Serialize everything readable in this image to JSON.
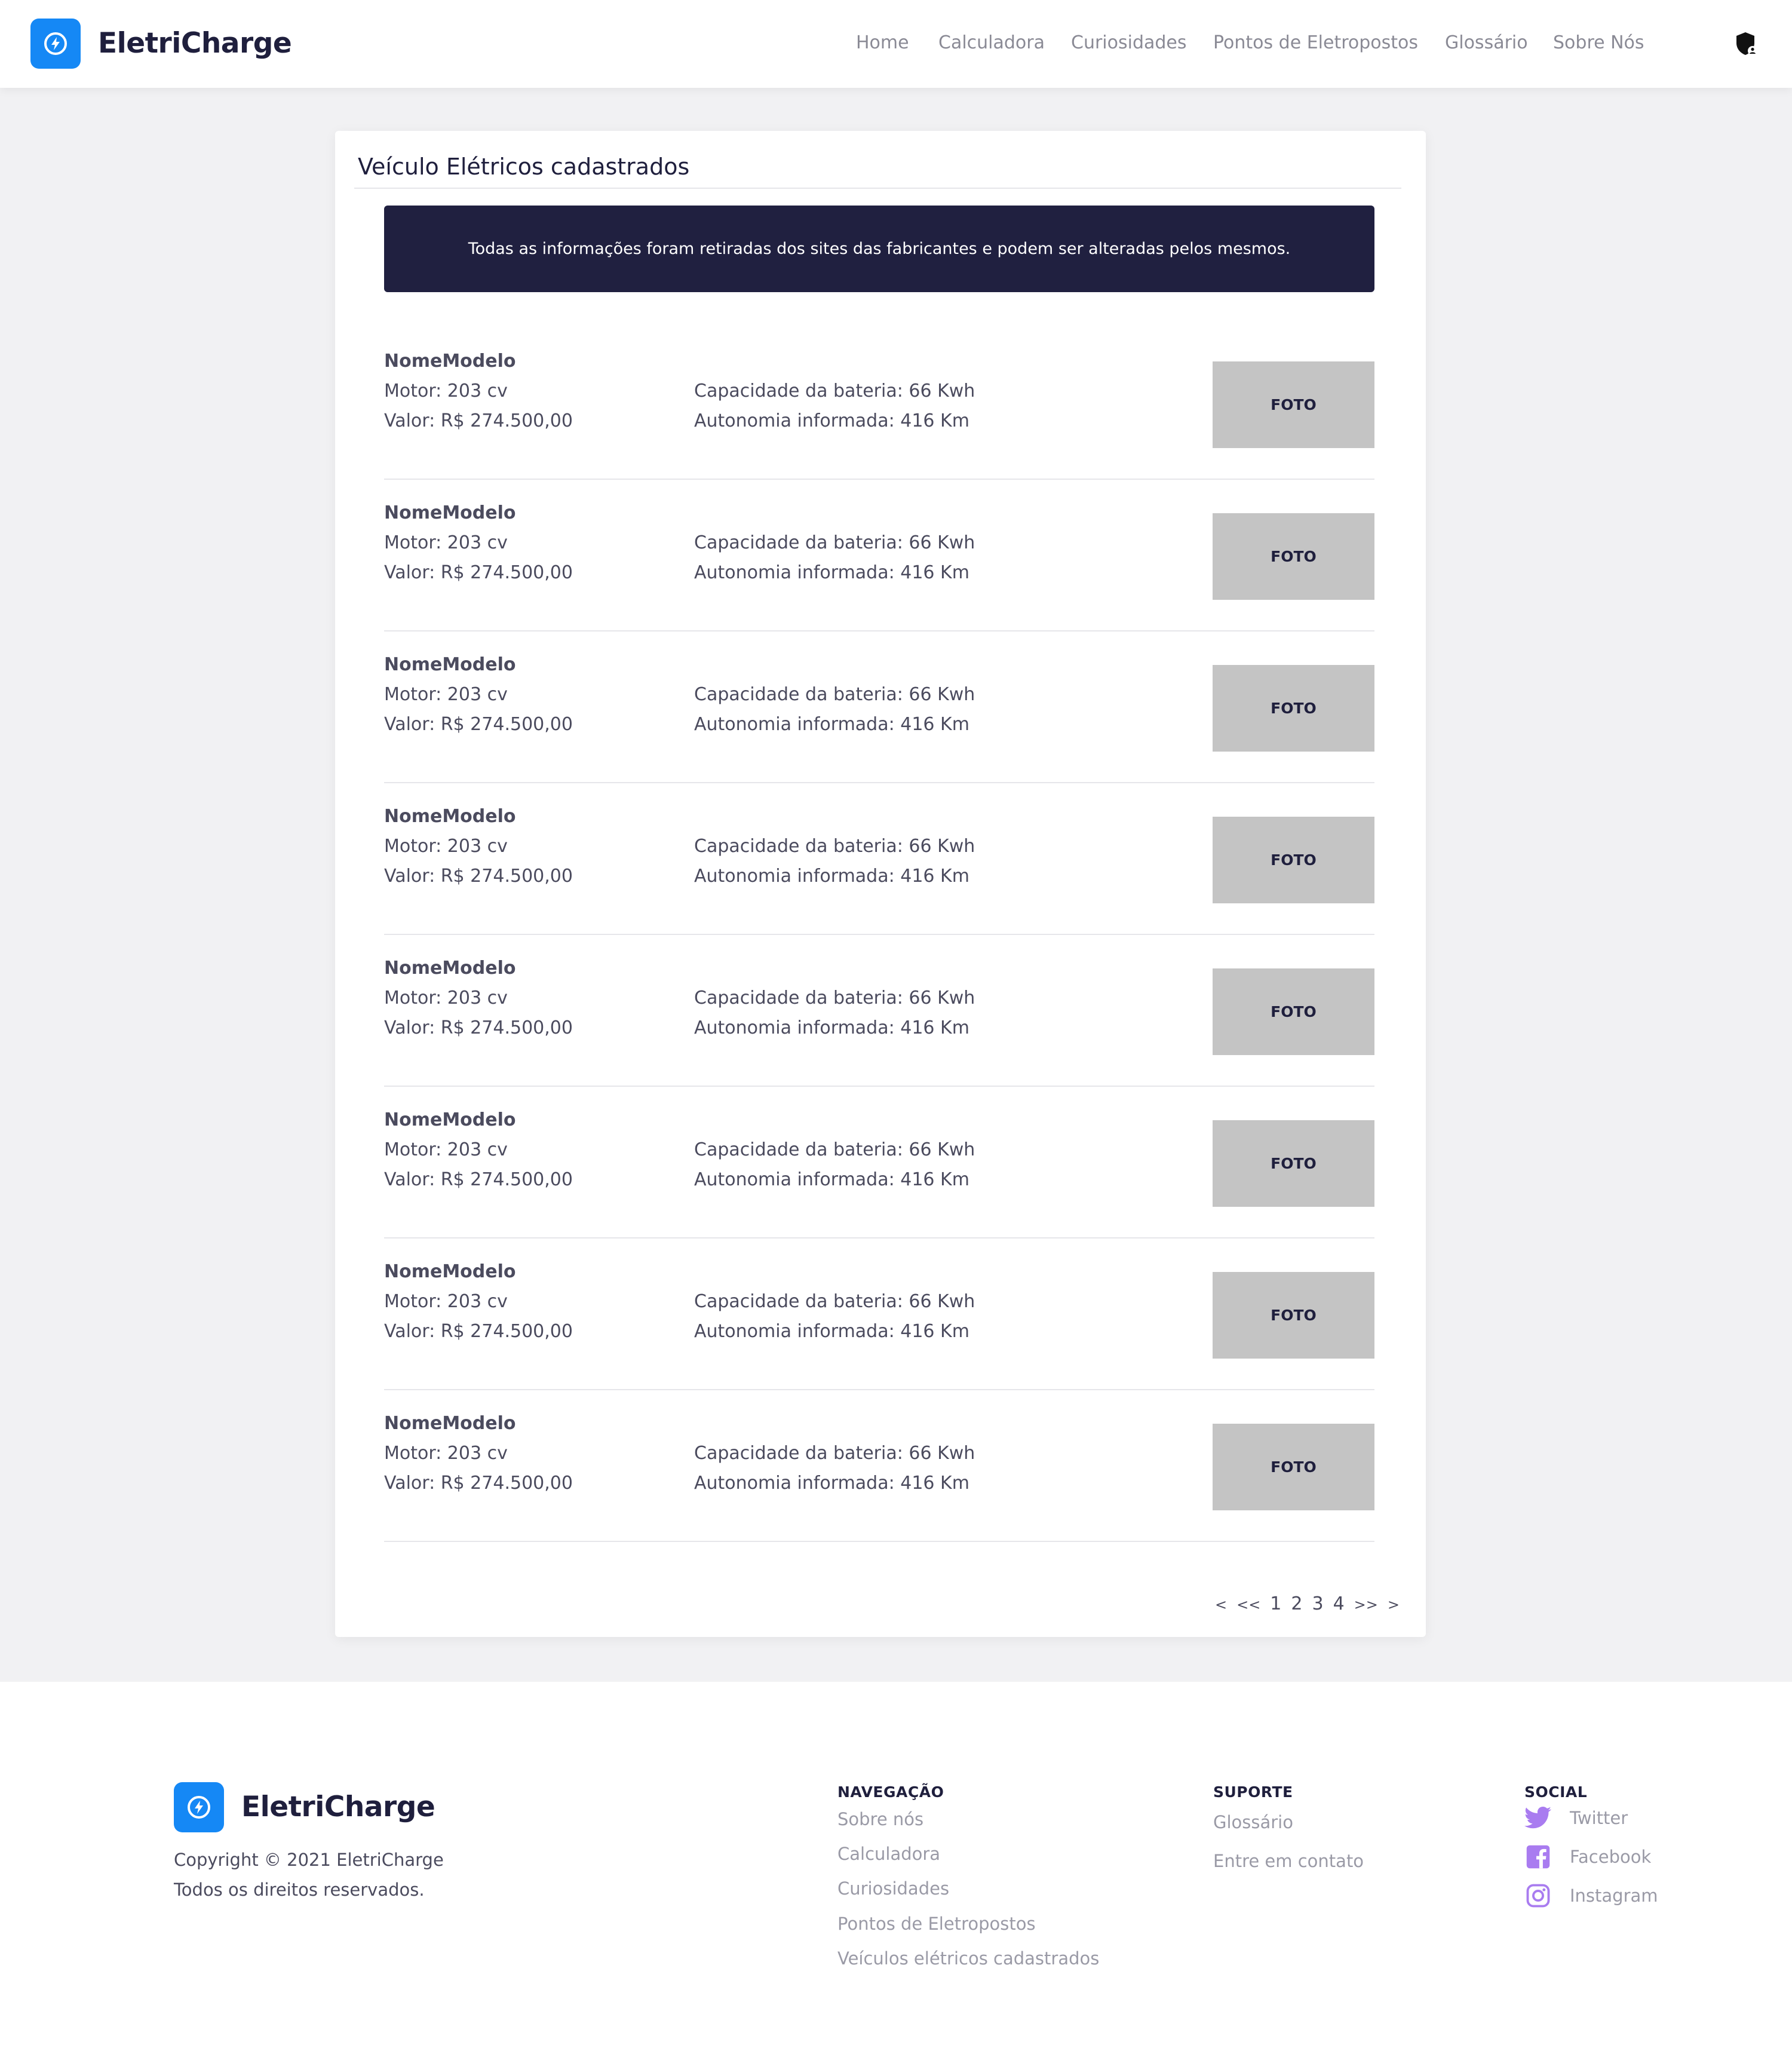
{
  "brand": {
    "name": "EletriCharge",
    "color": "#1588f5"
  },
  "header": {
    "nav": [
      {
        "label": "Home"
      },
      {
        "label": "Calculadora"
      },
      {
        "label": "Curiosidades"
      },
      {
        "label": "Pontos de Eletropostos"
      },
      {
        "label": "Glossário"
      },
      {
        "label": "Sobre Nós"
      }
    ],
    "admin_icon": "shield-user-icon"
  },
  "main": {
    "title": "Veículo Elétricos cadastrados",
    "notice": "Todas as informações foram retiradas dos sites das fabricantes e podem ser alteradas pelos mesmos.",
    "vehicles": [
      {
        "name": "NomeModelo",
        "motor": "Motor: 203 cv",
        "price": "Valor: R$ 274.500,00",
        "battery": "Capacidade da bateria: 66 Kwh",
        "range": "Autonomia informada: 416 Km",
        "photo": "FOTO"
      },
      {
        "name": "NomeModelo",
        "motor": "Motor: 203 cv",
        "price": "Valor: R$ 274.500,00",
        "battery": "Capacidade da bateria: 66 Kwh",
        "range": "Autonomia informada: 416 Km",
        "photo": "FOTO"
      },
      {
        "name": "NomeModelo",
        "motor": "Motor: 203 cv",
        "price": "Valor: R$ 274.500,00",
        "battery": "Capacidade da bateria: 66 Kwh",
        "range": "Autonomia informada: 416 Km",
        "photo": "FOTO"
      },
      {
        "name": "NomeModelo",
        "motor": "Motor: 203 cv",
        "price": "Valor: R$ 274.500,00",
        "battery": "Capacidade da bateria: 66 Kwh",
        "range": "Autonomia informada: 416 Km",
        "photo": "FOTO"
      },
      {
        "name": "NomeModelo",
        "motor": "Motor: 203 cv",
        "price": "Valor: R$ 274.500,00",
        "battery": "Capacidade da bateria: 66 Kwh",
        "range": "Autonomia informada: 416 Km",
        "photo": "FOTO"
      },
      {
        "name": "NomeModelo",
        "motor": "Motor: 203 cv",
        "price": "Valor: R$ 274.500,00",
        "battery": "Capacidade da bateria: 66 Kwh",
        "range": "Autonomia informada: 416 Km",
        "photo": "FOTO"
      },
      {
        "name": "NomeModelo",
        "motor": "Motor: 203 cv",
        "price": "Valor: R$ 274.500,00",
        "battery": "Capacidade da bateria: 66 Kwh",
        "range": "Autonomia informada: 416 Km",
        "photo": "FOTO"
      },
      {
        "name": "NomeModelo",
        "motor": "Motor: 203 cv",
        "price": "Valor: R$ 274.500,00",
        "battery": "Capacidade da bateria: 66 Kwh",
        "range": "Autonomia informada: 416 Km",
        "photo": "FOTO"
      }
    ],
    "pagination": {
      "prev": "<",
      "first": "<<",
      "pages": [
        "1",
        "2",
        "3",
        "4"
      ],
      "last": ">>",
      "next": ">"
    }
  },
  "footer": {
    "copyright": "Copyright © 2021 EletriCharge",
    "rights": "Todos os direitos reservados.",
    "navigation": {
      "title": "NAVEGAÇÃO",
      "links": [
        "Sobre nós",
        "Calculadora",
        "Curiosidades",
        "Pontos de Eletropostos",
        "Veículos elétricos cadastrados"
      ]
    },
    "support": {
      "title": "SUPORTE",
      "links": [
        "Glossário",
        "Entre em contato"
      ]
    },
    "social": {
      "title": "SOCIAL",
      "color": "#a97cf0",
      "links": [
        {
          "label": "Twitter",
          "icon": "twitter-icon"
        },
        {
          "label": "Facebook",
          "icon": "facebook-icon"
        },
        {
          "label": "Instagram",
          "icon": "instagram-icon"
        }
      ]
    }
  },
  "colors": {
    "dark": "#1f1f3d",
    "notice_bg": "#202040",
    "photo_bg": "#c4c4c4",
    "page_bg": "#f1f1f3"
  }
}
